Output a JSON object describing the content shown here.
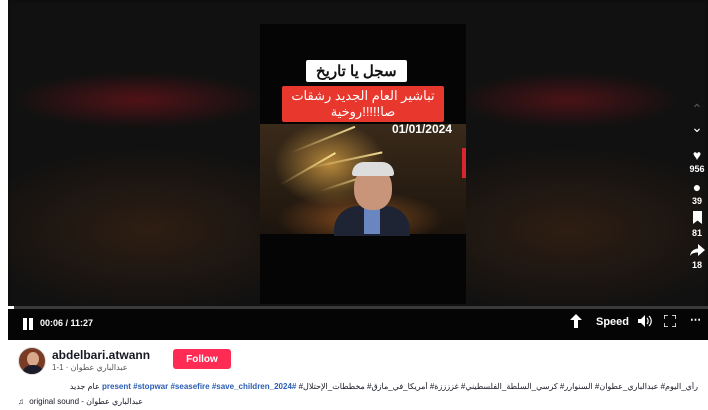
{
  "video": {
    "overlay_title": "سجل يا تاريخ",
    "overlay_subtitle": "تباشير العام الجديد رشقات صا!!!!!روخية",
    "date_stamp": "01/01/2024"
  },
  "actions": {
    "likes": "956",
    "comments": "39",
    "saves": "81",
    "shares": "18"
  },
  "player": {
    "time_display": "00:06 / 11:27",
    "progress": 0.009,
    "speed_label": "Speed"
  },
  "author": {
    "username": "abdelbari.atwann",
    "subline": "1-1 · عبدالباري عطوان",
    "follow_label": "Follow"
  },
  "caption": {
    "text": "رأي_اليوم# عبدالباري_عطوان# السنوارر# كرسي_السلطة_الفلسطيني# غززززة# أمريكا_في_مأزق# مخططات_الإحتلال#",
    "hashtags": "#2024_present #stopwar #seasefire #save_children",
    "suffix": "عام جديد"
  },
  "music": {
    "label": "original sound - عبدالباري عطوان"
  },
  "icons": {
    "pause": "pause-icon",
    "like": "heart-icon",
    "comment": "comment-icon",
    "save": "bookmark-icon",
    "share": "share-icon",
    "volume": "volume-icon",
    "fullscreen": "fullscreen-icon",
    "more": "more-icon"
  }
}
